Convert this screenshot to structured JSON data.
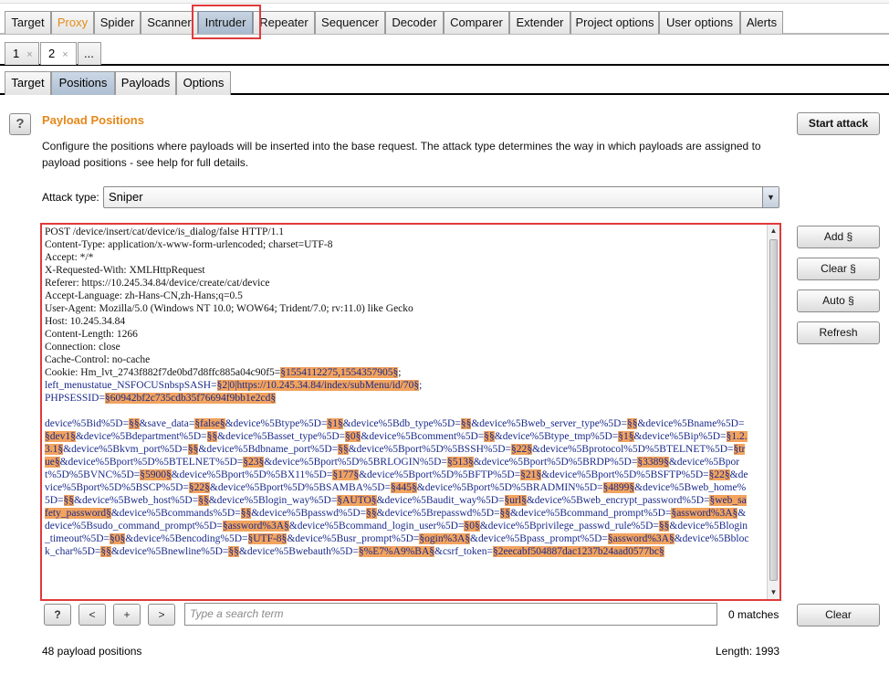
{
  "main_tabs": [
    {
      "label": "Target"
    },
    {
      "label": "Proxy"
    },
    {
      "label": "Spider"
    },
    {
      "label": "Scanner"
    },
    {
      "label": "Intruder"
    },
    {
      "label": "Repeater"
    },
    {
      "label": "Sequencer"
    },
    {
      "label": "Decoder"
    },
    {
      "label": "Comparer"
    },
    {
      "label": "Extender"
    },
    {
      "label": "Project options"
    },
    {
      "label": "User options"
    },
    {
      "label": "Alerts"
    }
  ],
  "attack_tabs": [
    {
      "label": "1",
      "close": "×"
    },
    {
      "label": "2",
      "close": "×"
    },
    {
      "label": "..."
    }
  ],
  "sub_tabs": [
    {
      "label": "Target"
    },
    {
      "label": "Positions"
    },
    {
      "label": "Payloads"
    },
    {
      "label": "Options"
    }
  ],
  "panel": {
    "title": "Payload Positions",
    "description": "Configure the positions where payloads will be inserted into the base request. The attack type determines the way in which payloads are assigned to payload positions - see help for full details.",
    "attack_type_label": "Attack type:",
    "attack_type_value": "Sniper",
    "help_glyph": "?"
  },
  "buttons": {
    "start_attack": "Start attack",
    "add": "Add §",
    "clear_markers": "Clear §",
    "auto": "Auto §",
    "refresh": "Refresh",
    "clear": "Clear"
  },
  "request": {
    "headers": [
      "POST /device/insert/cat/device/is_dialog/false HTTP/1.1",
      "Content-Type: application/x-www-form-urlencoded; charset=UTF-8",
      "Accept: */*",
      "X-Requested-With: XMLHttpRequest",
      "Referer: https://10.245.34.84/device/create/cat/device",
      "Accept-Language: zh-Hans-CN,zh-Hans;q=0.5",
      "User-Agent: Mozilla/5.0 (Windows NT 10.0; WOW64; Trident/7.0; rv:11.0) like Gecko",
      "Host: 10.245.34.84",
      "Content-Length: 1266",
      "Connection: close",
      "Cache-Control: no-cache"
    ],
    "cookie_prefix": "Cookie: Hm_lvt_2743f882f7de0bd7d8ffc885a04c90f5=",
    "cookie_payload": "§1554112275,1554357905§",
    "cookie_suffix": ";",
    "menustate_prefix": "left_menustatue_NSFOCUSnbspSASH=",
    "menustate_payload": "§2|0|https://10.245.34.84/index/subMenu/id/70§",
    "menustate_suffix": ";",
    "session_prefix": "PHPSESSID=",
    "session_payload": "§60942bf2c735cdb35f76694f9bb1e2cd§",
    "body": [
      {
        "t": "device%5Bid%5D="
      },
      {
        "p": "§§"
      },
      {
        "t": "&save_data="
      },
      {
        "p": "§false§"
      },
      {
        "t": "&device%5Btype%5D="
      },
      {
        "p": "§1§"
      },
      {
        "t": "&device%5Bdb_type%5D="
      },
      {
        "p": "§§"
      },
      {
        "t": "&device%5Bweb_server_type%5D="
      },
      {
        "p": "§§"
      },
      {
        "t": "&device%5Bname%5D="
      },
      {
        "p": "§dev1§"
      },
      {
        "t": "&device%5Bdepartment%5D="
      },
      {
        "p": "§§"
      },
      {
        "t": "&device%5Basset_type%5D="
      },
      {
        "p": "§0§"
      },
      {
        "t": "&device%5Bcomment%5D="
      },
      {
        "p": "§§"
      },
      {
        "t": "&device%5Btype_tmp%5D="
      },
      {
        "p": "§1§"
      },
      {
        "t": "&device%5Bip%5D="
      },
      {
        "p": "§1.2.3.1§"
      },
      {
        "t": "&device%5Bkvm_port%5D="
      },
      {
        "p": "§§"
      },
      {
        "t": "&device%5Bdbname_port%5D="
      },
      {
        "p": "§§"
      },
      {
        "t": "&device%5Bport%5D%5BSSH%5D="
      },
      {
        "p": "§22§"
      },
      {
        "t": "&device%5Bprotocol%5D%5BTELNET%5D="
      },
      {
        "p": "§true§"
      },
      {
        "t": "&device%5Bport%5D%5BTELNET%5D="
      },
      {
        "p": "§23§"
      },
      {
        "t": "&device%5Bport%5D%5BRLOGIN%5D="
      },
      {
        "p": "§513§"
      },
      {
        "t": "&device%5Bport%5D%5BRDP%5D="
      },
      {
        "p": "§3389§"
      },
      {
        "t": "&device%5Bport%5D%5BVNC%5D="
      },
      {
        "p": "§5900§"
      },
      {
        "t": "&device%5Bport%5D%5BX11%5D="
      },
      {
        "p": "§177§"
      },
      {
        "t": "&device%5Bport%5D%5BFTP%5D="
      },
      {
        "p": "§21§"
      },
      {
        "t": "&device%5Bport%5D%5BSFTP%5D="
      },
      {
        "p": "§22§"
      },
      {
        "t": "&device%5Bport%5D%5BSCP%5D="
      },
      {
        "p": "§22§"
      },
      {
        "t": "&device%5Bport%5D%5BSAMBA%5D="
      },
      {
        "p": "§445§"
      },
      {
        "t": "&device%5Bport%5D%5BRADMIN%5D="
      },
      {
        "p": "§4899§"
      },
      {
        "t": "&device%5Bweb_home%5D="
      },
      {
        "p": "§§"
      },
      {
        "t": "&device%5Bweb_host%5D="
      },
      {
        "p": "§§"
      },
      {
        "t": "&device%5Blogin_way%5D="
      },
      {
        "p": "§AUTO§"
      },
      {
        "t": "&device%5Baudit_way%5D="
      },
      {
        "p": "§url§"
      },
      {
        "t": "&device%5Bweb_encrypt_password%5D="
      },
      {
        "p": "§web_safety_password§"
      },
      {
        "t": "&device%5Bcommands%5D="
      },
      {
        "p": "§§"
      },
      {
        "t": "&device%5Bpasswd%5D="
      },
      {
        "p": "§§"
      },
      {
        "t": "&device%5Brepasswd%5D="
      },
      {
        "p": "§§"
      },
      {
        "t": "&device%5Bcommand_prompt%5D="
      },
      {
        "p": "§assword%3A§"
      },
      {
        "t": "&device%5Bsudo_command_prompt%5D="
      },
      {
        "p": "§assword%3A§"
      },
      {
        "t": "&device%5Bcommand_login_user%5D="
      },
      {
        "p": "§0§"
      },
      {
        "t": "&device%5Bprivilege_passwd_rule%5D="
      },
      {
        "p": "§§"
      },
      {
        "t": "&device%5Blogin_timeout%5D="
      },
      {
        "p": "§0§"
      },
      {
        "t": "&device%5Bencoding%5D="
      },
      {
        "p": "§UTF-8§"
      },
      {
        "t": "&device%5Busr_prompt%5D="
      },
      {
        "p": "§ogin%3A§"
      },
      {
        "t": "&device%5Bpass_prompt%5D="
      },
      {
        "p": "§assword%3A§"
      },
      {
        "t": "&device%5Bblock_char%5D="
      },
      {
        "p": "§§"
      },
      {
        "t": "&device%5Bnewline%5D="
      },
      {
        "p": "§§"
      },
      {
        "t": "&device%5Bwebauth%5D="
      },
      {
        "p": "§%E7%A9%BA§"
      },
      {
        "t": "&csrf_token="
      },
      {
        "p": "§2eecabf504887dac1237b24aad0577bc§"
      }
    ]
  },
  "search": {
    "placeholder": "Type a search term",
    "help": "?",
    "prev": "<",
    "add": "+",
    "next": ">",
    "matches": "0 matches"
  },
  "footer": {
    "payload_positions": "48 payload positions",
    "length": "Length: 1993"
  },
  "colors": {
    "accent_orange": "#e6881a",
    "payload_highlight": "#f2a35e",
    "annotation_red": "#e03a3a",
    "body_text_blue": "#1a2a8a"
  }
}
